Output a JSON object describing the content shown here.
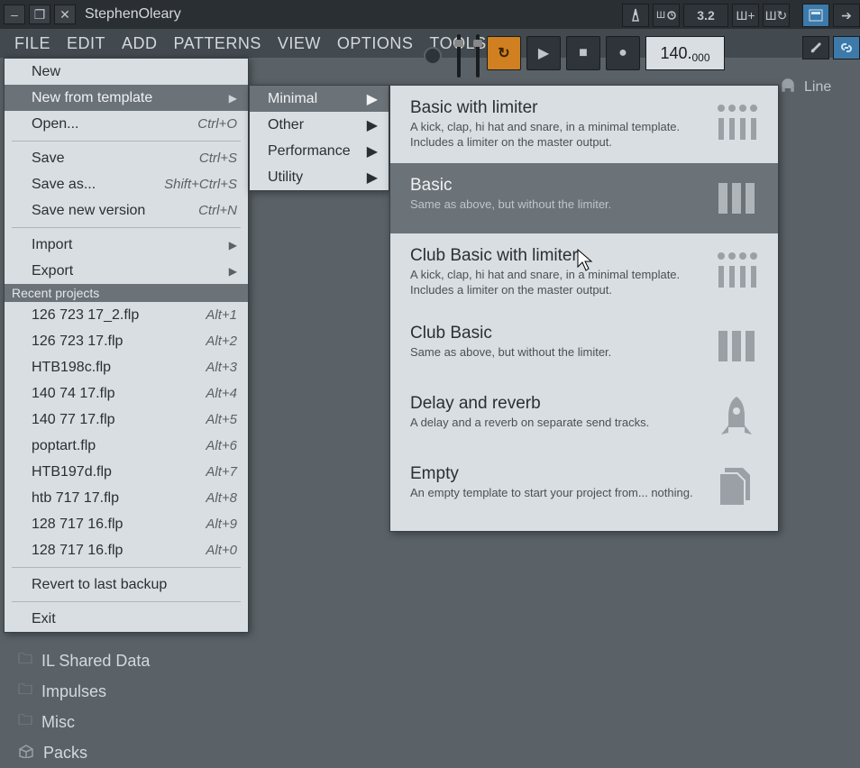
{
  "titlebar": {
    "title": "StephenOleary"
  },
  "menubar": {
    "items": [
      "FILE",
      "EDIT",
      "ADD",
      "PATTERNS",
      "VIEW",
      "OPTIONS",
      "TOOLS",
      "?"
    ]
  },
  "top_toolbar": {
    "time_sig": "3.2"
  },
  "transport": {
    "tempo": "140.",
    "tempo_decimal": "000"
  },
  "channel_label": "Line",
  "file_menu": {
    "items_top": [
      {
        "label": "New",
        "shortcut": "",
        "submenu": false,
        "key": "new"
      },
      {
        "label": "New from template",
        "shortcut": "",
        "submenu": true,
        "highlighted": true,
        "key": "new-template"
      },
      {
        "label": "Open...",
        "shortcut": "Ctrl+O",
        "submenu": false,
        "key": "open"
      }
    ],
    "items_save": [
      {
        "label": "Save",
        "shortcut": "Ctrl+S",
        "key": "save"
      },
      {
        "label": "Save as...",
        "shortcut": "Shift+Ctrl+S",
        "key": "save-as"
      },
      {
        "label": "Save new version",
        "shortcut": "Ctrl+N",
        "key": "save-new-version"
      }
    ],
    "items_io": [
      {
        "label": "Import",
        "shortcut": "",
        "submenu": true,
        "key": "import"
      },
      {
        "label": "Export",
        "shortcut": "",
        "submenu": true,
        "key": "export"
      }
    ],
    "recent_header": "Recent projects",
    "recent": [
      {
        "label": "126 723 17_2.flp",
        "shortcut": "Alt+1"
      },
      {
        "label": "126 723 17.flp",
        "shortcut": "Alt+2"
      },
      {
        "label": "HTB198c.flp",
        "shortcut": "Alt+3"
      },
      {
        "label": "140 74 17.flp",
        "shortcut": "Alt+4"
      },
      {
        "label": "140 77 17.flp",
        "shortcut": "Alt+5"
      },
      {
        "label": "poptart.flp",
        "shortcut": "Alt+6"
      },
      {
        "label": "HTB197d.flp",
        "shortcut": "Alt+7"
      },
      {
        "label": "htb 717 17.flp",
        "shortcut": "Alt+8"
      },
      {
        "label": "128 717 16.flp",
        "shortcut": "Alt+9"
      },
      {
        "label": "128 717 16.flp",
        "shortcut": "Alt+0"
      }
    ],
    "revert": "Revert to last backup",
    "exit": "Exit"
  },
  "template_categories": [
    {
      "label": "Minimal",
      "highlighted": true
    },
    {
      "label": "Other"
    },
    {
      "label": "Performance"
    },
    {
      "label": "Utility"
    }
  ],
  "templates": [
    {
      "title": "Basic with limiter",
      "desc": "A kick, clap, hi hat and snare, in a minimal template. Includes a limiter on the master output.",
      "icon": "mixer-dots"
    },
    {
      "title": "Basic",
      "desc": "Same as above, but without the limiter.",
      "icon": "bars",
      "highlighted": true
    },
    {
      "title": "Club Basic with limiter",
      "desc": "A kick, clap, hi hat and snare, in a minimal template. Includes a limiter on the master output.",
      "icon": "mixer-dots"
    },
    {
      "title": "Club Basic",
      "desc": "Same as above, but without the limiter.",
      "icon": "bars"
    },
    {
      "title": "Delay and reverb",
      "desc": "A delay and a reverb on separate send tracks.",
      "icon": "rocket"
    },
    {
      "title": "Empty",
      "desc": "An empty template to start your project from... nothing.",
      "icon": "files"
    }
  ],
  "browser_items": [
    {
      "label": "IL Shared Data",
      "icon": "folder"
    },
    {
      "label": "Impulses",
      "icon": "folder"
    },
    {
      "label": "Misc",
      "icon": "folder"
    },
    {
      "label": "Packs",
      "icon": "package"
    }
  ]
}
